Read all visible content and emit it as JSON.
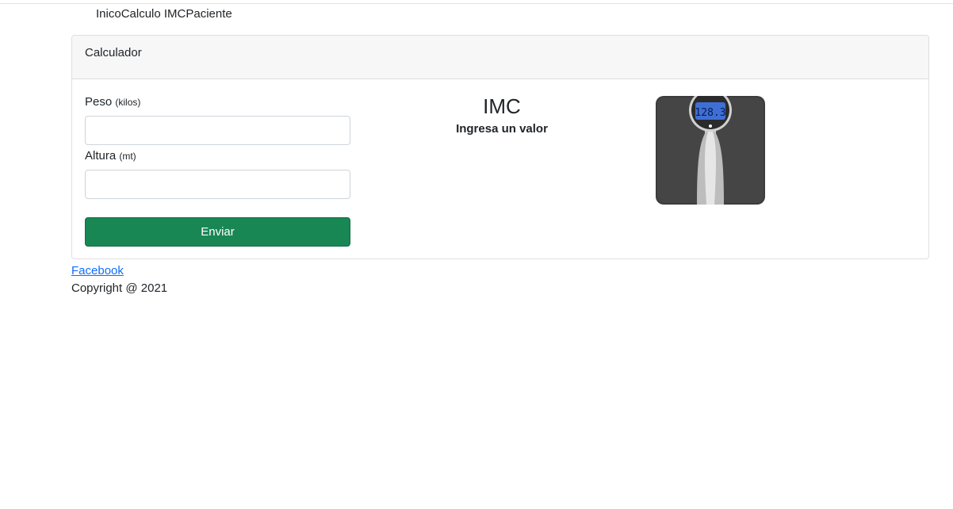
{
  "nav": {
    "items": [
      "Inico",
      "Calculo IMC",
      "Paciente"
    ]
  },
  "card": {
    "header": "Calculador",
    "form": {
      "peso_label": "Peso",
      "peso_unit": "(kilos)",
      "peso_value": "",
      "altura_label": "Altura",
      "altura_unit": "(mt)",
      "altura_value": "",
      "submit_label": "Enviar"
    },
    "result": {
      "title": "IMC",
      "message": "Ingresa un valor"
    },
    "scale_display": "128.3"
  },
  "footer": {
    "link": "Facebook",
    "copyright": "Copyright @ 2021"
  },
  "colors": {
    "button": "#198754",
    "link": "#0d6efd",
    "header_bg": "#f7f7f7",
    "scale_body": "#3c3c3c",
    "scale_screen": "#3f6fd6"
  }
}
